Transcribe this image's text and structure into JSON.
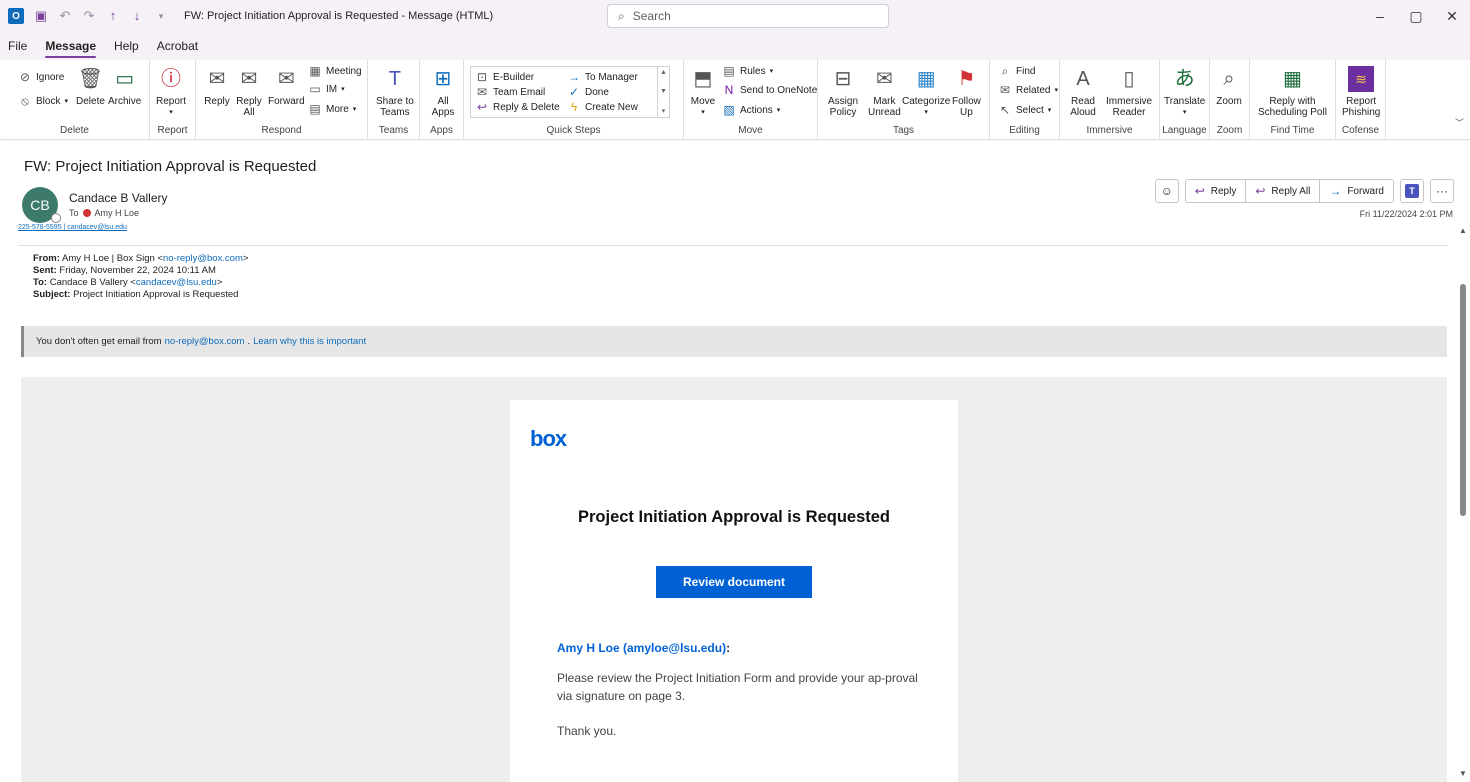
{
  "window": {
    "title": "FW: Project Initiation Approval is Requested  -  Message (HTML)",
    "search_placeholder": "Search",
    "icons": [
      "outlook-logo",
      "save-icon",
      "undo-icon",
      "redo-icon",
      "up-arrow-icon",
      "down-arrow-icon",
      "customize-icon"
    ]
  },
  "menu": {
    "tabs": [
      "File",
      "Message",
      "Help",
      "Acrobat"
    ],
    "active": "Message"
  },
  "ribbon": {
    "delete_group": {
      "label": "Delete",
      "ignore": "Ignore",
      "block": "Block",
      "delete": "Delete",
      "archive": "Archive"
    },
    "report_group": {
      "label": "Report",
      "report": "Report"
    },
    "respond_group": {
      "label": "Respond",
      "reply": "Reply",
      "reply_all_1": "Reply",
      "reply_all_2": "All",
      "forward": "Forward",
      "meeting": "Meeting",
      "im": "IM",
      "more": "More"
    },
    "teams_group": {
      "label": "Teams",
      "share_1": "Share to",
      "share_2": "Teams"
    },
    "apps_group": {
      "label": "Apps",
      "all_1": "All",
      "all_2": "Apps"
    },
    "quicksteps_group": {
      "label": "Quick Steps",
      "items": [
        "E-Builder",
        "Team Email",
        "Reply & Delete",
        "To Manager",
        "Done",
        "Create New"
      ]
    },
    "move_group": {
      "label": "Move",
      "move": "Move",
      "rules": "Rules",
      "onenote": "Send to OneNote",
      "actions": "Actions"
    },
    "tags_group": {
      "label": "Tags",
      "assign_1": "Assign",
      "assign_2": "Policy",
      "mark_1": "Mark",
      "mark_2": "Unread",
      "categorize": "Categorize",
      "follow_1": "Follow",
      "follow_2": "Up"
    },
    "editing_group": {
      "label": "Editing",
      "find": "Find",
      "related": "Related",
      "select": "Select"
    },
    "immersive_group": {
      "label": "Immersive",
      "read_1": "Read",
      "read_2": "Aloud",
      "imm_1": "Immersive",
      "imm_2": "Reader"
    },
    "language_group": {
      "label": "Language",
      "translate": "Translate"
    },
    "zoom_group": {
      "label": "Zoom",
      "zoom": "Zoom"
    },
    "findtime_group": {
      "label": "Find Time",
      "reply_1": "Reply with",
      "reply_2": "Scheduling Poll"
    },
    "cofense_group": {
      "label": "Cofense",
      "report_1": "Report",
      "report_2": "Phishing"
    }
  },
  "message": {
    "subject": "FW: Project Initiation Approval is Requested",
    "avatar_initials": "CB",
    "sender": "Candace B Vallery",
    "to_label": "To",
    "to": "Amy H Loe",
    "partial_line": "225-578-5595  |  candacev@lsu.edu",
    "date": "Fri 11/22/2024 2:01 PM",
    "actions": {
      "reply": "Reply",
      "reply_all": "Reply All",
      "forward": "Forward",
      "more": "···"
    }
  },
  "body": {
    "from_label": "From:",
    "from_name": "Amy H Loe | Box Sign <",
    "from_email": "no-reply@box.com",
    "from_end": ">",
    "sent_label": "Sent:",
    "sent": "Friday, November 22, 2024 10:11 AM",
    "to_label": "To:",
    "to_name": "Candace B Vallery <",
    "to_email": "candacev@lsu.edu",
    "to_end": ">",
    "subject_label": "Subject:",
    "subject": "Project Initiation Approval is Requested",
    "warning_prefix": "You don't often get email from",
    "warning_email": "no-reply@box.com",
    "warning_link": "Learn why this is important"
  },
  "card": {
    "logo": "box",
    "title": "Project Initiation Approval is Requested",
    "button": "Review document",
    "requester": "Amy H Loe (amyloe@lsu.edu)",
    "message": "Please review the Project Initiation Form and provide your ap-proval via signature on page 3.",
    "thanks": "Thank you."
  },
  "colors": {
    "accent": "#7a3f9a",
    "box_blue": "#0061d5",
    "link": "#0f6cbd"
  }
}
